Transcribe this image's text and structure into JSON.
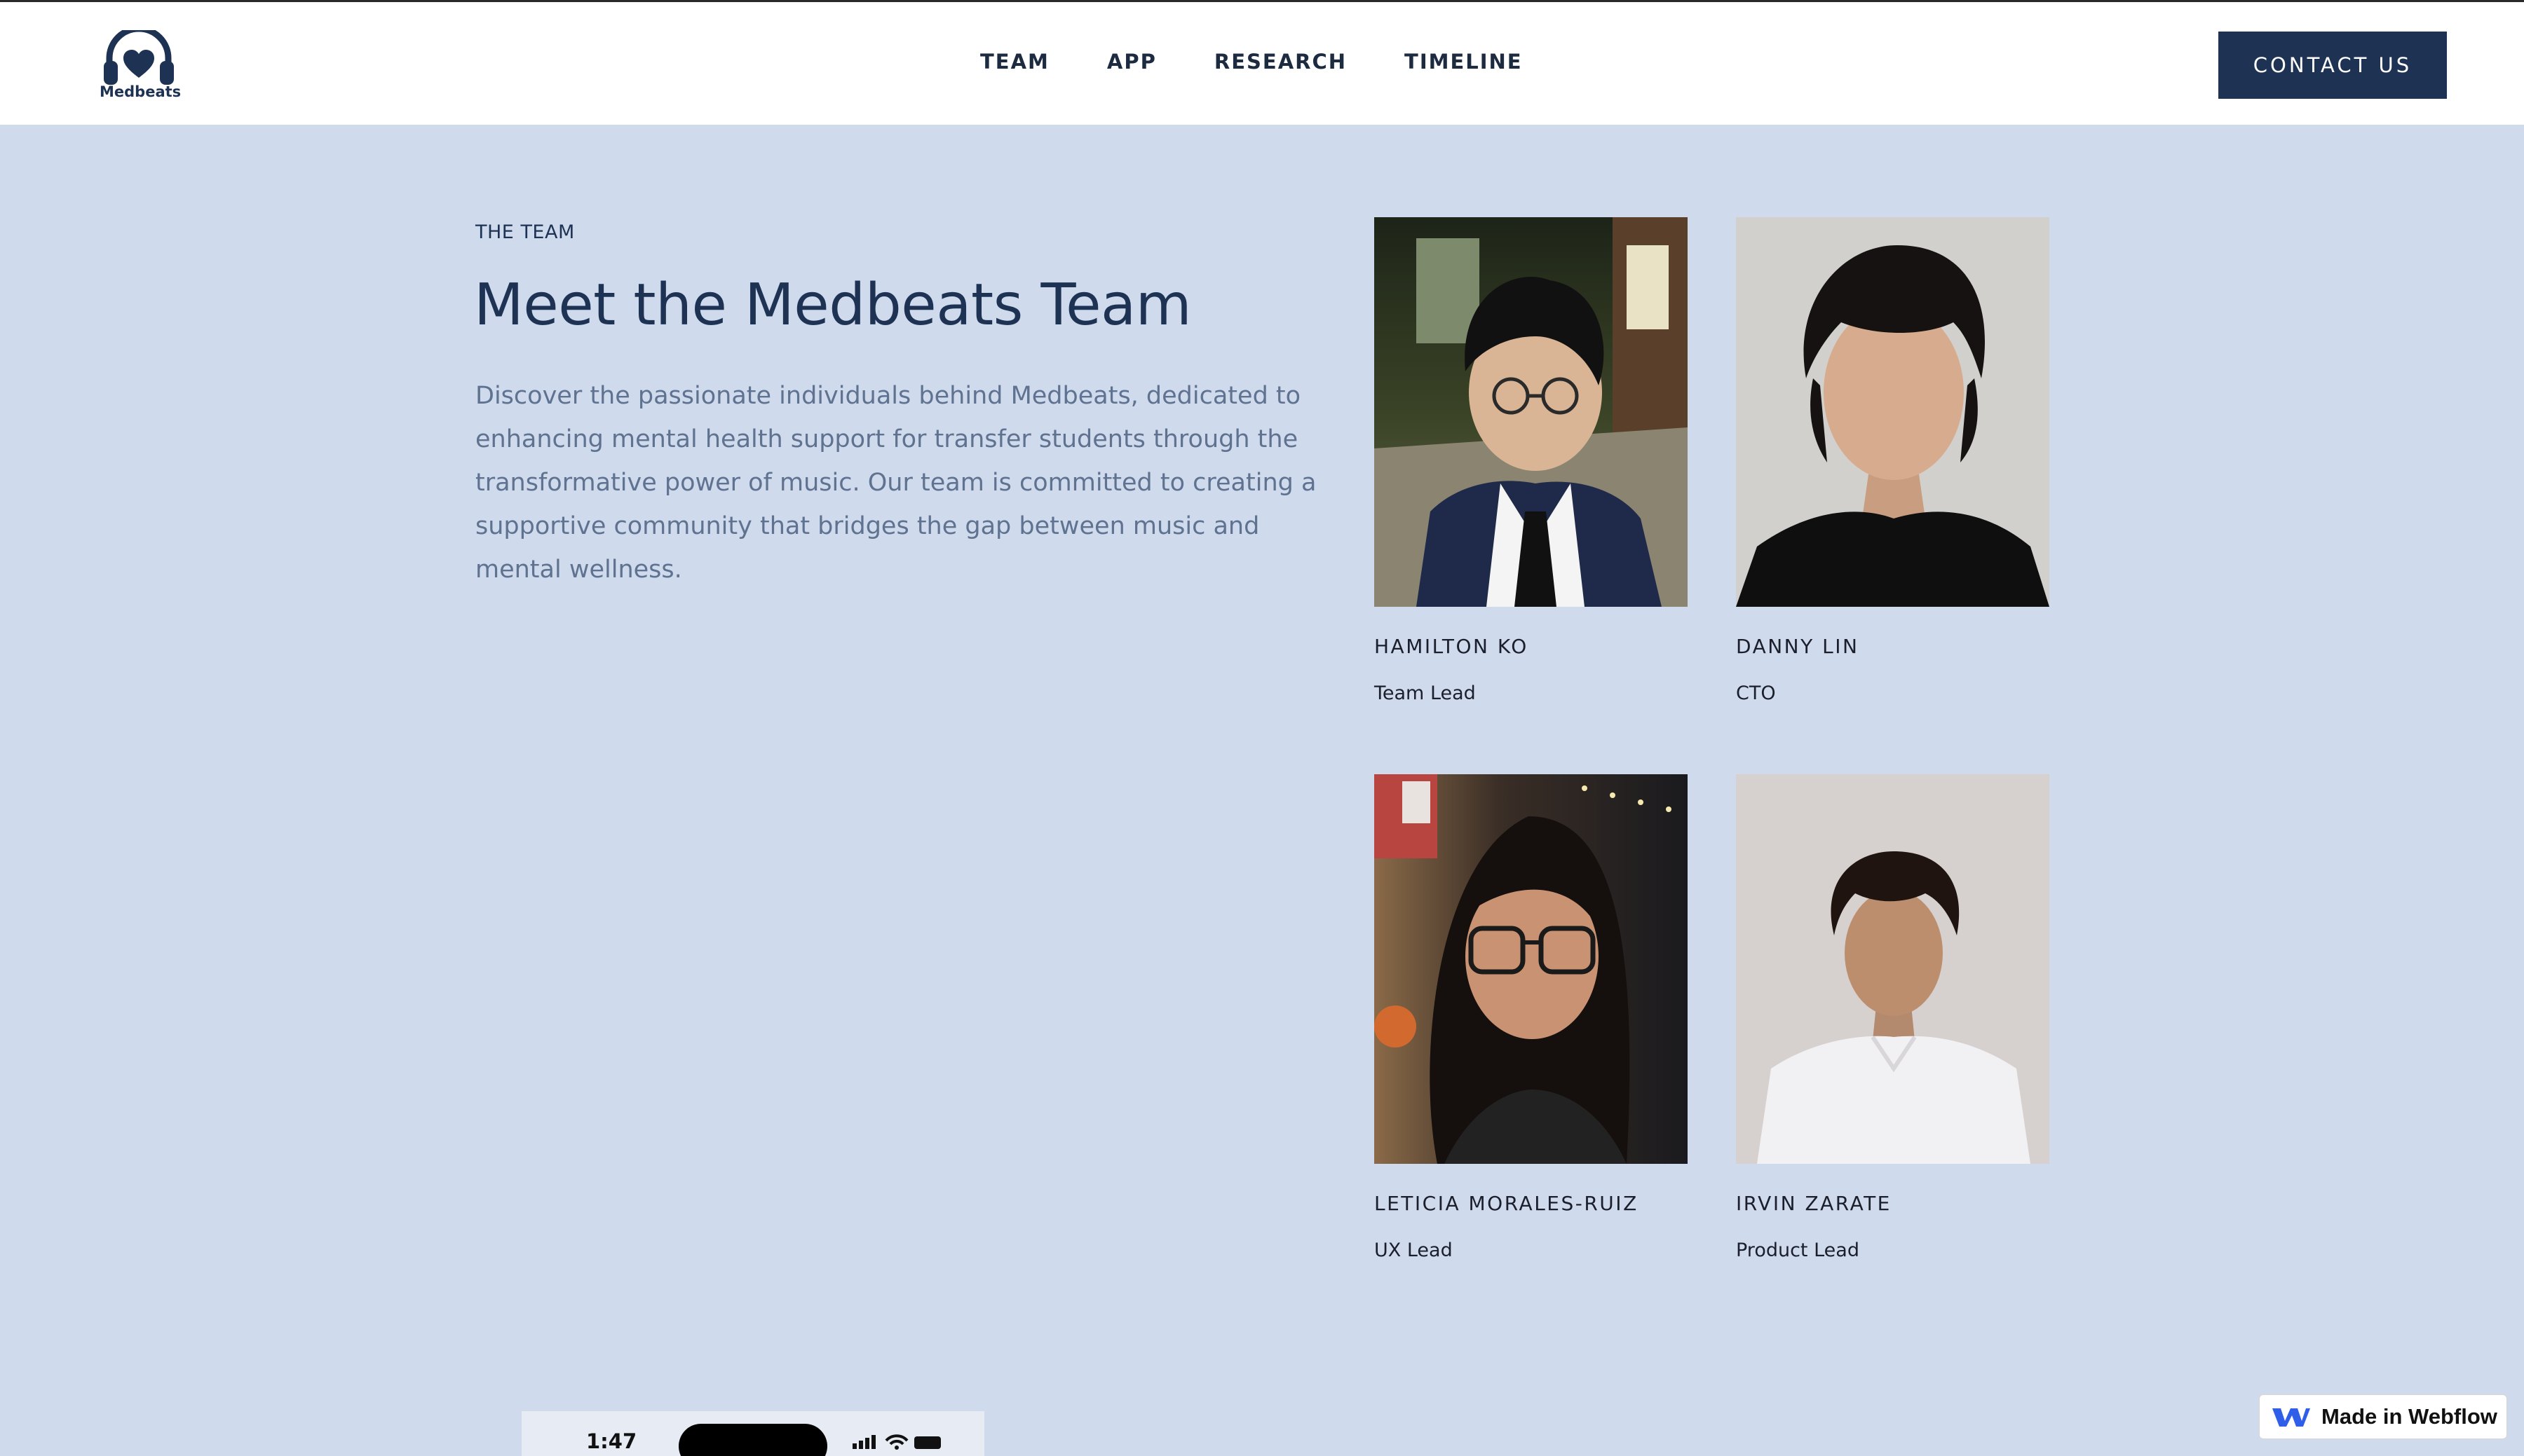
{
  "brand": {
    "name": "Medbeats",
    "accent": "#1e3354",
    "background": "#cfdaec"
  },
  "nav": {
    "links": [
      {
        "label": "TEAM"
      },
      {
        "label": "APP"
      },
      {
        "label": "RESEARCH"
      },
      {
        "label": "TIMELINE"
      }
    ],
    "cta_label": "CONTACT US"
  },
  "hero": {
    "eyebrow": "THE TEAM",
    "title": "Meet the Medbeats Team",
    "description": "Discover the passionate individuals behind Medbeats, dedicated to enhancing mental health support for transfer students through the transformative power of music. Our team is committed to creating a supportive community that bridges the gap between music and mental wellness."
  },
  "team": [
    {
      "name": "HAMILTON KO",
      "role": "Team Lead"
    },
    {
      "name": "DANNY LIN",
      "role": "CTO"
    },
    {
      "name": "LETICIA MORALES-RUIZ",
      "role": "UX Lead"
    },
    {
      "name": "IRVIN ZARATE",
      "role": "Product Lead"
    }
  ],
  "phone": {
    "time": "1:47"
  },
  "badge": {
    "label": "Made in Webflow"
  }
}
